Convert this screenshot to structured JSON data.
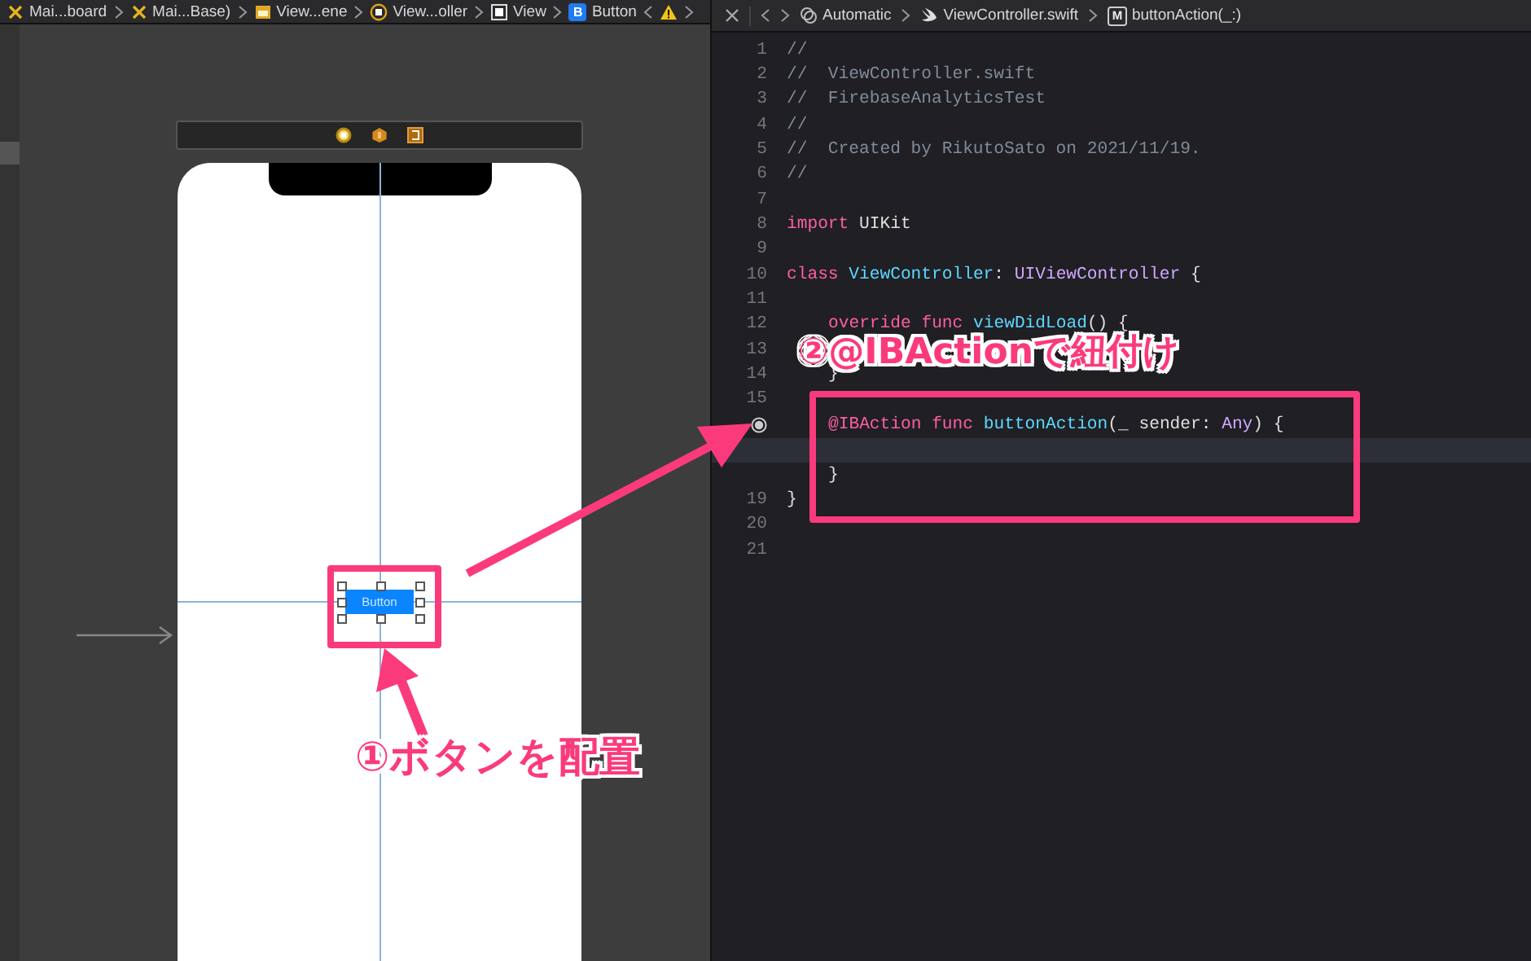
{
  "jump_bar": {
    "items": [
      {
        "kind": "storyboard",
        "label": "Mai...board"
      },
      {
        "kind": "storyboard",
        "label": "Mai...Base)"
      },
      {
        "kind": "scene",
        "label": "View...ene"
      },
      {
        "kind": "controller",
        "label": "View...oller"
      },
      {
        "kind": "view",
        "label": "View"
      },
      {
        "kind": "button",
        "badge": "B",
        "label": "Button"
      }
    ]
  },
  "editor_bar": {
    "items": [
      {
        "kind": "automatic",
        "label": "Automatic"
      },
      {
        "kind": "swift",
        "label": "ViewController.swift"
      },
      {
        "kind": "method",
        "badge": "M",
        "label": "buttonAction(_:)"
      }
    ]
  },
  "canvas": {
    "button": {
      "label": "Button",
      "selected": true
    }
  },
  "code": {
    "lines": [
      {
        "num": "1",
        "current": false,
        "tokens": [
          {
            "kind": "comment",
            "text": "//"
          }
        ]
      },
      {
        "num": "2",
        "current": false,
        "tokens": [
          {
            "kind": "comment",
            "text": "//  ViewController.swift"
          }
        ]
      },
      {
        "num": "3",
        "current": false,
        "tokens": [
          {
            "kind": "comment",
            "text": "//  FirebaseAnalyticsTest"
          }
        ]
      },
      {
        "num": "4",
        "current": false,
        "tokens": [
          {
            "kind": "comment",
            "text": "//"
          }
        ]
      },
      {
        "num": "5",
        "current": false,
        "tokens": [
          {
            "kind": "comment",
            "text": "//  Created by RikutoSato on 2021/11/19."
          }
        ]
      },
      {
        "num": "6",
        "current": false,
        "tokens": [
          {
            "kind": "comment",
            "text": "//"
          }
        ]
      },
      {
        "num": "7",
        "current": false
      },
      {
        "num": "8",
        "current": false,
        "tokens": [
          {
            "kind": "keyword",
            "text": "import "
          },
          {
            "kind": "plain",
            "text": "UIKit"
          }
        ]
      },
      {
        "num": "9",
        "current": false
      },
      {
        "num": "10",
        "current": false,
        "tokens": [
          {
            "kind": "keyword",
            "text": "class "
          },
          {
            "kind": "declared",
            "text": "ViewController"
          },
          {
            "kind": "plain",
            "text": ": "
          },
          {
            "kind": "system",
            "text": "UIViewController"
          },
          {
            "kind": "plain",
            "text": " {"
          }
        ]
      },
      {
        "num": "11",
        "current": false
      },
      {
        "num": "12",
        "current": false,
        "indented": true,
        "tokens": [
          {
            "kind": "keyword",
            "text": "override func "
          },
          {
            "kind": "declared",
            "text": "viewDidLoad"
          },
          {
            "kind": "plain",
            "text": "() {"
          }
        ]
      },
      {
        "num": "13",
        "current": false
      },
      {
        "num": "14",
        "current": false,
        "indented": true,
        "tokens": [
          {
            "kind": "plain",
            "text": "}"
          }
        ]
      },
      {
        "num": "15",
        "current": false
      },
      {
        "connected": true,
        "current": false,
        "indented": true,
        "tokens": [
          {
            "kind": "keyword",
            "text": "@IBAction func "
          },
          {
            "kind": "declared",
            "text": "buttonAction"
          },
          {
            "kind": "plain",
            "text": "(_ sender: "
          },
          {
            "kind": "system",
            "text": "Any"
          },
          {
            "kind": "plain",
            "text": ") {"
          }
        ]
      },
      {
        "current": true
      },
      {
        "current": false,
        "indented": true,
        "tokens": [
          {
            "kind": "plain",
            "text": "}"
          }
        ]
      },
      {
        "num": "19",
        "current": false,
        "tokens": [
          {
            "kind": "plain",
            "text": "}"
          }
        ]
      },
      {
        "num": "20",
        "current": false
      },
      {
        "num": "21",
        "current": false
      }
    ]
  },
  "annotations": [
    {
      "text": "①ボタンを配置"
    },
    {
      "text": "②@IBActionで紐付け"
    }
  ]
}
